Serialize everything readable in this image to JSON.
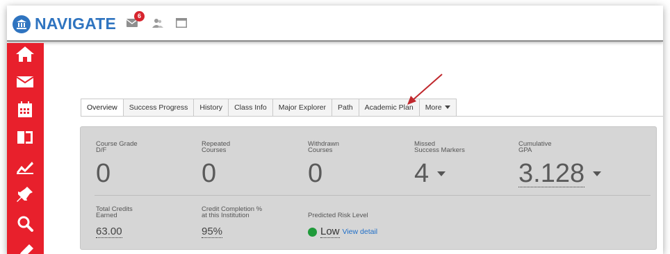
{
  "header": {
    "app_name": "NAVIGATE",
    "mail_badge": "6",
    "icons": [
      "navigate-logo-icon",
      "mail-icon",
      "people-icon",
      "window-icon"
    ]
  },
  "sidebar": {
    "icons": [
      "home-icon",
      "mail-icon",
      "calendar-icon",
      "folder-icon",
      "chart-icon",
      "pin-icon",
      "search-icon",
      "pencil-icon"
    ]
  },
  "tabs": [
    {
      "label": "Overview"
    },
    {
      "label": "Success Progress"
    },
    {
      "label": "History"
    },
    {
      "label": "Class Info"
    },
    {
      "label": "Major Explorer"
    },
    {
      "label": "Path"
    },
    {
      "label": "Academic Plan"
    },
    {
      "label": "More"
    }
  ],
  "metrics": {
    "course_grade": {
      "label1": "Course Grade",
      "label2": "D/F",
      "value": "0"
    },
    "repeated": {
      "label1": "Repeated",
      "label2": "Courses",
      "value": "0"
    },
    "withdrawn": {
      "label1": "Withdrawn",
      "label2": "Courses",
      "value": "0"
    },
    "missed": {
      "label1": "Missed",
      "label2": "Success Markers",
      "value": "4"
    },
    "gpa": {
      "label1": "Cumulative",
      "label2": "GPA",
      "value": "3.128"
    },
    "total_credits": {
      "label1": "Total Credits",
      "label2": "Earned",
      "value": "63.00"
    },
    "completion": {
      "label1": "Credit Completion %",
      "label2": "at this Institution",
      "value": "95%"
    },
    "risk": {
      "label": "Predicted Risk Level",
      "value": "Low",
      "link": "View detail"
    }
  },
  "colors": {
    "brand_blue": "#2f74c0",
    "sidebar_red": "#e8202c",
    "risk_green": "#1f9a3a",
    "annotation_arrow": "#c0282d"
  }
}
